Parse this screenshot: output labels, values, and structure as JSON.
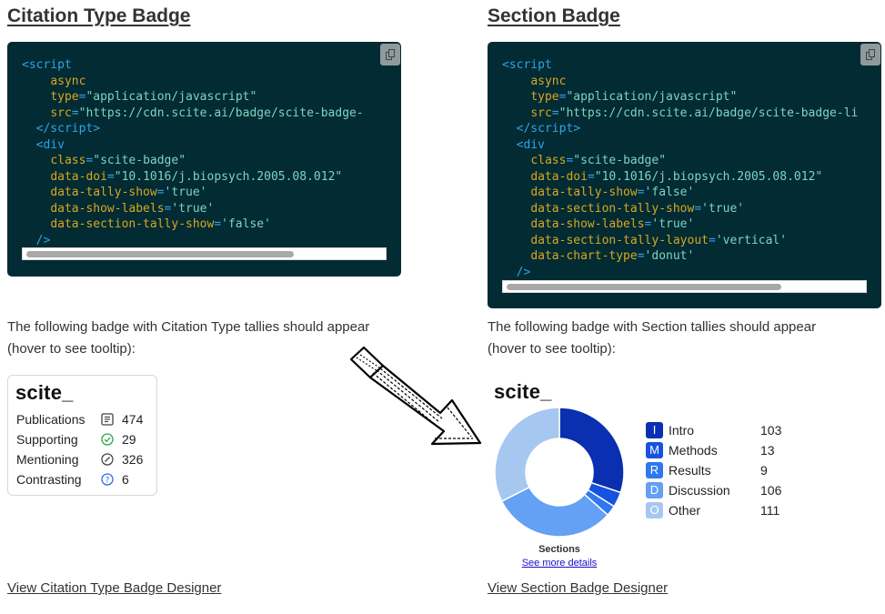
{
  "left": {
    "title": "Citation Type Badge",
    "description_line1": "The following badge with Citation Type tallies should appear",
    "description_line2": "(hover to see tooltip):",
    "badge": {
      "logo": "scite_",
      "rows": [
        {
          "label": "Publications",
          "icon": "document-icon",
          "value": "474"
        },
        {
          "label": "Supporting",
          "icon": "check-circle-icon",
          "value": "29"
        },
        {
          "label": "Mentioning",
          "icon": "mention-circle-icon",
          "value": "326"
        },
        {
          "label": "Contrasting",
          "icon": "question-circle-icon",
          "value": "6"
        }
      ]
    },
    "designer_link": "View Citation Type Badge Designer"
  },
  "right": {
    "title": "Section Badge",
    "description_line1": "The following badge with Section tallies should appear",
    "description_line2": "(hover to see tooltip):",
    "badge": {
      "logo": "scite_",
      "sections_label": "Sections",
      "see_more": "See more details",
      "legend": [
        {
          "letter": "I",
          "name": "Intro",
          "count": "103",
          "color": "#0a2fb0"
        },
        {
          "letter": "M",
          "name": "Methods",
          "count": "13",
          "color": "#1852e0"
        },
        {
          "letter": "R",
          "name": "Results",
          "count": "9",
          "color": "#2e78f0"
        },
        {
          "letter": "D",
          "name": "Discussion",
          "count": "106",
          "color": "#64a0f4"
        },
        {
          "letter": "O",
          "name": "Other",
          "count": "111",
          "color": "#a6c8f0"
        }
      ]
    },
    "designer_link": "View Section Badge Designer"
  },
  "colors": {
    "code_background": "#022b33",
    "tag": "#2fa4e8",
    "attribute": "#d7a821",
    "string": "#7ed3c2",
    "check": "#2aa84a",
    "question": "#2a6ee8"
  },
  "chart_data": {
    "type": "pie",
    "style": "donut",
    "categories": [
      "Intro",
      "Methods",
      "Results",
      "Discussion",
      "Other"
    ],
    "values": [
      103,
      13,
      9,
      106,
      111
    ],
    "colors": [
      "#0a2fb0",
      "#1852e0",
      "#2e78f0",
      "#64a0f4",
      "#a6c8f0"
    ],
    "title": "Sections"
  }
}
